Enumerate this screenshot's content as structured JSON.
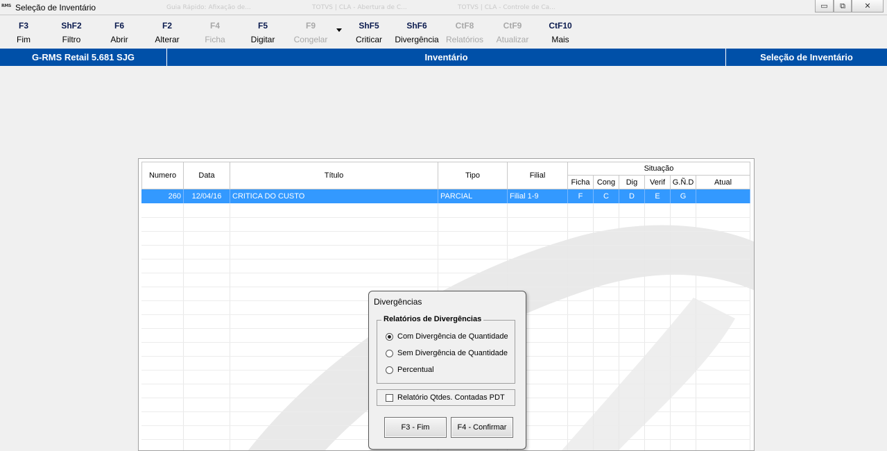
{
  "window": {
    "app_logo": "RMS",
    "title": "Seleção de Inventário",
    "ghost_tabs": [
      "Guia Rápido: Afixação de...",
      "TOTVS | CLA - Abertura de C...",
      "TOTVS | CLA - Controle de Ca..."
    ],
    "buttons": {
      "minimize": "▭",
      "restore": "⧉",
      "close": "✕"
    }
  },
  "toolbar": {
    "items": [
      {
        "key": "F3",
        "label": "Fim",
        "enabled": true
      },
      {
        "key": "ShF2",
        "label": "Filtro",
        "enabled": true
      },
      {
        "key": "F6",
        "label": "Abrir",
        "enabled": true
      },
      {
        "key": "F2",
        "label": "Alterar",
        "enabled": true
      },
      {
        "key": "F4",
        "label": "Ficha",
        "enabled": false
      },
      {
        "key": "F5",
        "label": "Digitar",
        "enabled": true
      },
      {
        "key": "F9",
        "label": "Congelar",
        "enabled": false
      },
      {
        "key": "ShF5",
        "label": "Criticar",
        "enabled": true
      },
      {
        "key": "ShF6",
        "label": "Divergência",
        "enabled": true
      },
      {
        "key": "CtF8",
        "label": "Relatórios",
        "enabled": false
      },
      {
        "key": "CtF9",
        "label": "Atualizar",
        "enabled": false
      },
      {
        "key": "CtF10",
        "label": "Mais",
        "enabled": true
      }
    ]
  },
  "header": {
    "system": "G-RMS Retail 5.681 SJG",
    "module": "Inventário",
    "screen": "Seleção de Inventário"
  },
  "grid": {
    "columns": {
      "numero": "Numero",
      "data": "Data",
      "titulo": "Título",
      "tipo": "Tipo",
      "filial": "Filial",
      "situacao": "Situação",
      "ficha": "Ficha",
      "cong": "Cong",
      "dig": "Dig",
      "verif": "Verif",
      "gnd": "G.Ñ.D",
      "atual": "Atual"
    },
    "rows": [
      {
        "numero": "260",
        "data": "12/04/16",
        "titulo": "CRITICA DO CUSTO",
        "tipo": "PARCIAL",
        "filial": "Filial 1-9",
        "ficha": "F",
        "cong": "C",
        "dig": "D",
        "verif": "E",
        "gnd": "G",
        "atual": ""
      }
    ]
  },
  "dialog": {
    "title": "Divergências",
    "group_title": "Relatórios de Divergências",
    "options": [
      {
        "label": "Com Divergência de Quantidade",
        "selected": true
      },
      {
        "label": "Sem Divergência de Quantidade",
        "selected": false
      },
      {
        "label": "Percentual",
        "selected": false
      }
    ],
    "checkbox_label": "Relatório Qtdes. Contadas PDT",
    "checkbox_checked": false,
    "btn_fim": "F3 - Fim",
    "btn_confirmar": "F4 - Confirmar"
  }
}
